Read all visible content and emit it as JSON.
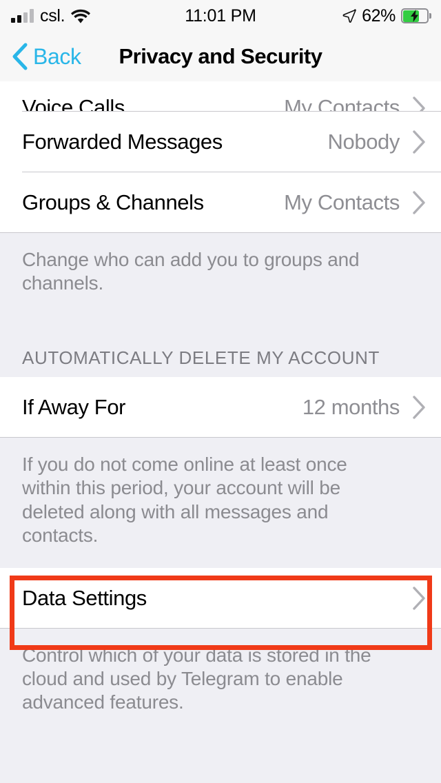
{
  "status_bar": {
    "carrier": "csl.",
    "time": "11:01 PM",
    "battery_percent": "62%",
    "signal_icon": "signal-bars-icon",
    "wifi_icon": "wifi-icon",
    "location_icon": "location-arrow-icon",
    "battery_icon": "battery-charging-icon",
    "battery_level": 62,
    "battery_charging": true
  },
  "nav_bar": {
    "back_label": "Back",
    "back_icon": "chevron-left-icon",
    "title": "Privacy and Security"
  },
  "colors": {
    "accent_blue": "#29B6E8",
    "group_background": "#EFEFF4",
    "row_background": "#FFFFFF",
    "separator": "#C8C7CC",
    "secondary_text": "#8E8E93",
    "footer_text": "#8B8B90",
    "annotation_red": "#F03A18",
    "battery_green": "#32CD42"
  },
  "rows": {
    "voice_calls": {
      "title": "Voice Calls",
      "value": "My Contacts",
      "chevron": "chevron-right-icon"
    },
    "forwarded_messages": {
      "title": "Forwarded Messages",
      "value": "Nobody",
      "chevron": "chevron-right-icon"
    },
    "groups_channels": {
      "title": "Groups & Channels",
      "value": "My Contacts",
      "chevron": "chevron-right-icon"
    },
    "if_away_for": {
      "title": "If Away For",
      "value": "12 months",
      "chevron": "chevron-right-icon"
    },
    "data_settings": {
      "title": "Data Settings",
      "value": "",
      "chevron": "chevron-right-icon"
    }
  },
  "footers": {
    "groups_channels": "Change who can add you to groups and channels.",
    "auto_delete": "If you do not come online at least once within this period, your account will be deleted along with all messages and contacts.",
    "data_settings": "Control which of your data is stored in the cloud and used by Telegram to enable advanced features."
  },
  "section_headers": {
    "auto_delete": "AUTOMATICALLY DELETE MY ACCOUNT"
  },
  "annotation": {
    "highlighted_element": "Data Settings",
    "shape": "rectangle-outline"
  }
}
